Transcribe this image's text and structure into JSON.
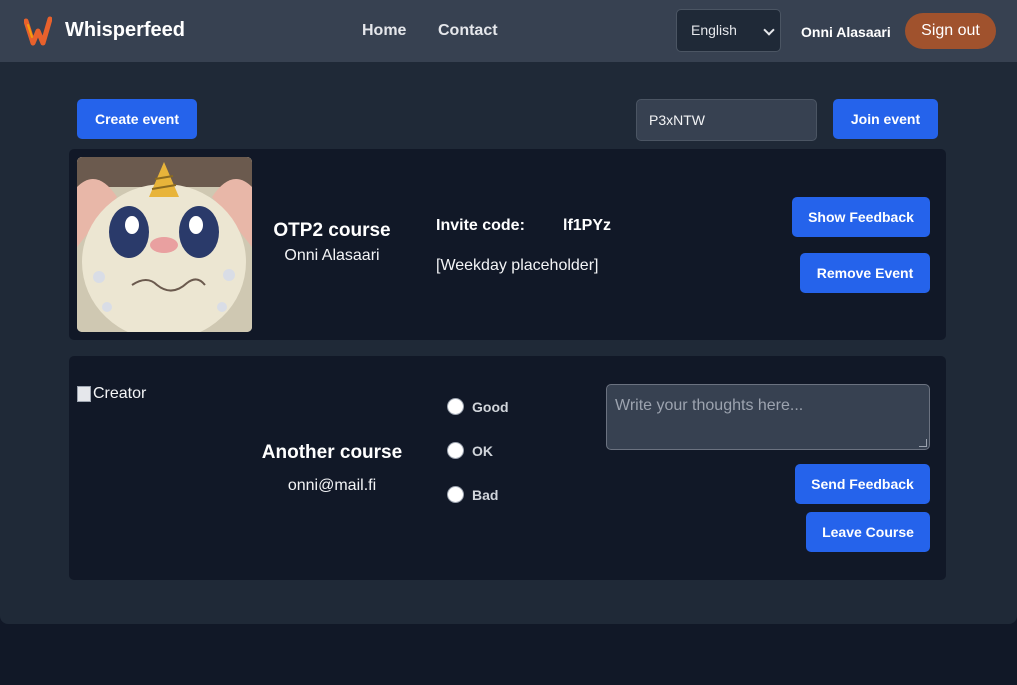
{
  "header": {
    "brand": "Whisperfeed",
    "logo_icon": "whisperfeed-logo",
    "nav": [
      {
        "label": "Home"
      },
      {
        "label": "Contact"
      }
    ],
    "language": {
      "selected": "English"
    },
    "user_name": "Onni Alasaari",
    "signout_label": "Sign out"
  },
  "toolbar": {
    "create_label": "Create event",
    "join_value": "P3xNTW",
    "join_label": "Join event"
  },
  "events": [
    {
      "title": "OTP2 course",
      "owner": "Onni Alasaari",
      "invite_label": "Invite code:",
      "invite_code": "lf1PYz",
      "weekday": "[Weekday placeholder]",
      "show_feedback_label": "Show Feedback",
      "remove_label": "Remove Event"
    },
    {
      "image_alt": "Creator",
      "title": "Another course",
      "owner": "onni@mail.fi",
      "ratings": [
        {
          "label": "Good"
        },
        {
          "label": "OK"
        },
        {
          "label": "Bad"
        }
      ],
      "thoughts_placeholder": "Write your thoughts here...",
      "send_label": "Send Feedback",
      "leave_label": "Leave Course"
    }
  ],
  "colors": {
    "accent": "#2563eb",
    "signout": "#a0522d",
    "header_bg": "#374151",
    "panel_bg": "#1f2937",
    "card_bg": "#111827"
  }
}
